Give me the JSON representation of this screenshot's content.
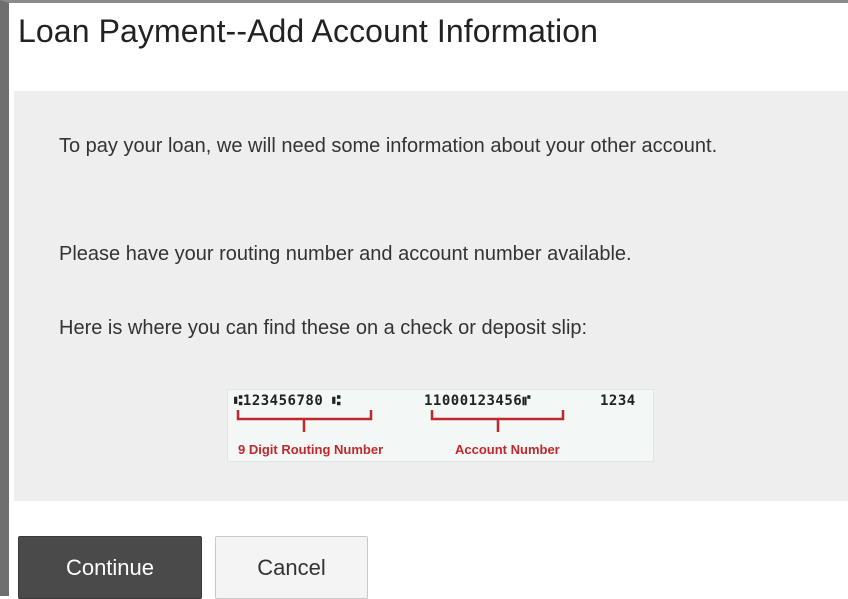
{
  "page": {
    "title": "Loan Payment--Add Account Information"
  },
  "panel": {
    "intro": "To pay your loan, we will need some information about your other account.",
    "instruction": "Please have your routing number and account number available.",
    "hint": "Here is where you can find these on a check or deposit slip:"
  },
  "check_image": {
    "routing_digits": "⑆123456780 ⑆",
    "account_digits": "11000123456⑈",
    "check_digits": "1234",
    "routing_label": "9 Digit Routing Number",
    "account_label": "Account Number",
    "label_color": "#c0282d"
  },
  "buttons": {
    "continue_label": "Continue",
    "cancel_label": "Cancel"
  }
}
